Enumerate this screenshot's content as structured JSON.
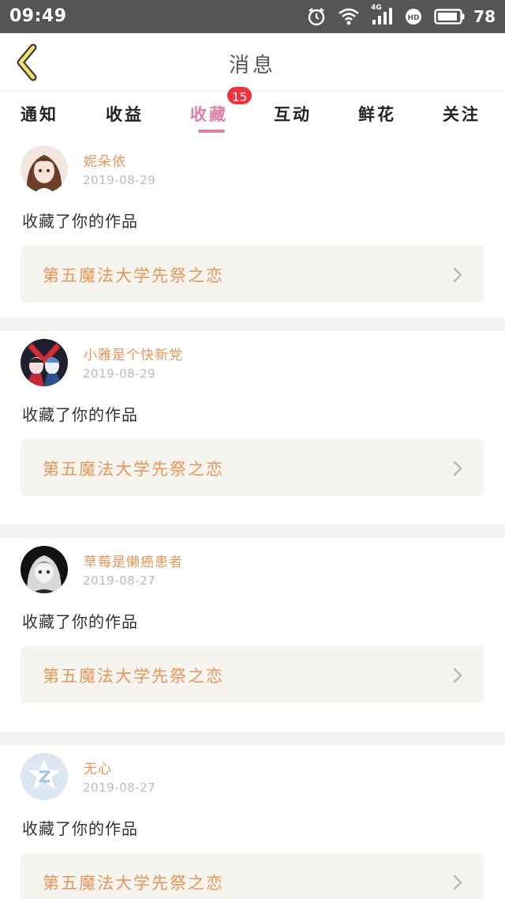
{
  "status_bar": {
    "time": "09:49",
    "network": "4G",
    "battery": "78",
    "icons": [
      "alarm-icon",
      "wifi-icon",
      "signal-icon",
      "hd-icon",
      "battery-icon"
    ]
  },
  "header": {
    "title": "消息",
    "back_icon": "chevron-left-icon"
  },
  "tabs": {
    "items": [
      {
        "label": "通知"
      },
      {
        "label": "收益"
      },
      {
        "label": "收藏"
      },
      {
        "label": "互动"
      },
      {
        "label": "鲜花"
      },
      {
        "label": "关注"
      }
    ],
    "active": "收藏",
    "badge": "15"
  },
  "colors": {
    "accent_pink": "#e07fa9",
    "username_orange": "#e8955a",
    "badge_red": "#f0343f",
    "work_box_bg": "#f5f4ee"
  },
  "feed": {
    "items": [
      {
        "username": "妮朵依",
        "date": "2019-08-29",
        "action": "收藏了你的作品",
        "work_title": "第五魔法大学先祭之恋"
      },
      {
        "username": "小雅是个快新党",
        "date": "2019-08-29",
        "action": "收藏了你的作品",
        "work_title": "第五魔法大学先祭之恋"
      },
      {
        "username": "草莓是懒癌患者",
        "date": "2019-08-27",
        "action": "收藏了你的作品",
        "work_title": "第五魔法大学先祭之恋"
      },
      {
        "username": "无心",
        "date": "2019-08-27",
        "action": "收藏了你的作品",
        "work_title": "第五魔法大学先祭之恋"
      }
    ]
  }
}
